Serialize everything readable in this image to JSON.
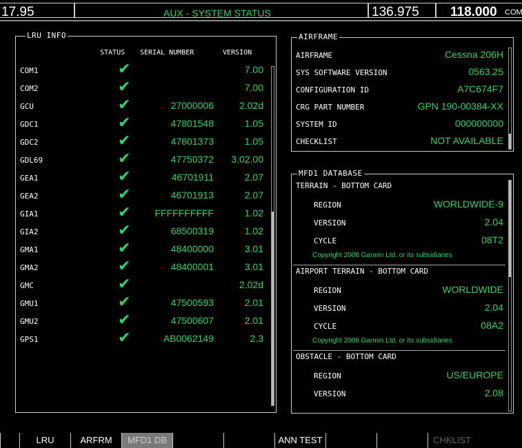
{
  "topbar": {
    "nav1_freq": "17.95",
    "page_title": "AUX - SYSTEM STATUS",
    "com_active": "136.975",
    "com_standby": "118.000",
    "com_label": "COM"
  },
  "lru": {
    "title": "LRU INFO",
    "headers": {
      "status": "STATUS",
      "serial": "SERIAL NUMBER",
      "version": "VERSION"
    },
    "rows": [
      {
        "name": "COM1",
        "serial": "",
        "version": "7.00"
      },
      {
        "name": "COM2",
        "serial": "",
        "version": "7.00"
      },
      {
        "name": "GCU",
        "serial": "27000006",
        "version": "2.02d"
      },
      {
        "name": "GDC1",
        "serial": "47801548",
        "version": "1.05"
      },
      {
        "name": "GDC2",
        "serial": "47801373",
        "version": "1.05"
      },
      {
        "name": "GDL69",
        "serial": "47750372",
        "version": "3.02.00"
      },
      {
        "name": "GEA1",
        "serial": "46701911",
        "version": "2.07"
      },
      {
        "name": "GEA2",
        "serial": "46701913",
        "version": "2.07"
      },
      {
        "name": "GIA1",
        "serial": "FFFFFFFFFF",
        "version": "1.02"
      },
      {
        "name": "GIA2",
        "serial": "68500319",
        "version": "1.02"
      },
      {
        "name": "GMA1",
        "serial": "48400000",
        "version": "3.01"
      },
      {
        "name": "GMA2",
        "serial": "48400001",
        "version": "3.01"
      },
      {
        "name": "GMC",
        "serial": "",
        "version": "2.02d"
      },
      {
        "name": "GMU1",
        "serial": "47500593",
        "version": "2.01"
      },
      {
        "name": "GMU2",
        "serial": "47500607",
        "version": "2.01"
      },
      {
        "name": "GPS1",
        "serial": "AB0062149",
        "version": "2.3"
      }
    ],
    "status_icon": "green-checkmark-icon"
  },
  "airframe": {
    "title": "AIRFRAME",
    "rows": [
      {
        "label": "AIRFRAME",
        "value": "Cessna 206H"
      },
      {
        "label": "SYS SOFTWARE VERSION",
        "value": "0563.25"
      },
      {
        "label": "CONFIGURATION ID",
        "value": "A7C674F7"
      },
      {
        "label": "CRG PART NUMBER",
        "value": "GPN 190-00384-XX"
      },
      {
        "label": "SYSTEM ID",
        "value": "000000000"
      },
      {
        "label": "CHECKLIST",
        "value": "NOT AVAILABLE"
      }
    ]
  },
  "mfd1_db": {
    "title": "MFD1 DATABASE",
    "sections": [
      {
        "heading": "TERRAIN - BOTTOM CARD",
        "rows": [
          {
            "label": "REGION",
            "value": "WORLDWIDE-9"
          },
          {
            "label": "VERSION",
            "value": "2.04"
          },
          {
            "label": "CYCLE",
            "value": "08T2"
          }
        ],
        "copyright": "Copyright 2008 Garmin Ltd. or its subsidiaries"
      },
      {
        "heading": "AIRPORT TERRAIN - BOTTOM CARD",
        "rows": [
          {
            "label": "REGION",
            "value": "WORLDWIDE"
          },
          {
            "label": "VERSION",
            "value": "2.04"
          },
          {
            "label": "CYCLE",
            "value": "08A2"
          }
        ],
        "copyright": "Copyright 2008 Garmin Ltd. or its subsidiaries"
      },
      {
        "heading": "OBSTACLE - BOTTOM CARD",
        "rows": [
          {
            "label": "REGION",
            "value": "US/EUROPE"
          },
          {
            "label": "VERSION",
            "value": "2.08"
          }
        ]
      }
    ]
  },
  "softkeys": [
    {
      "label": ""
    },
    {
      "label": "LRU"
    },
    {
      "label": "ARFRM"
    },
    {
      "label": "MFD1 DB",
      "active": true
    },
    {
      "label": ""
    },
    {
      "label": ""
    },
    {
      "label": "ANN TEST"
    },
    {
      "label": ""
    },
    {
      "label": ""
    },
    {
      "label": "CHKLIST",
      "disabled": true
    }
  ],
  "colors": {
    "accent": "#2fd36a",
    "background": "#000000"
  }
}
